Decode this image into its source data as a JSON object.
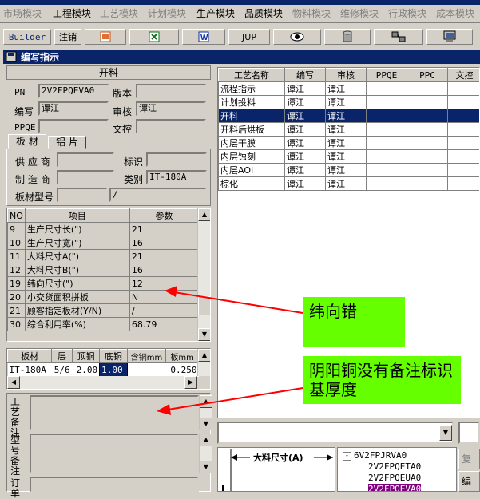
{
  "menu": [
    "市场模块",
    "工程模块",
    "工艺模块",
    "计划模块",
    "生产模块",
    "品质模块",
    "物料模块",
    "维修模块",
    "行政模块",
    "成本模块"
  ],
  "toolbar": {
    "builder": "Builder",
    "logout": "注销",
    "jup": "JUP"
  },
  "window_title": "编写指示",
  "section_title": "开料",
  "form": {
    "pn_label": "PN",
    "pn_value": "2V2FPQEVA0",
    "version_label": "版本",
    "version_value": "",
    "author_label": "编写",
    "author_value": "谭江",
    "review_label": "审核",
    "review_value": "谭江",
    "ppqe_label": "PPQE",
    "ppqe_value": "",
    "wenkong_label": "文控",
    "wenkong_value": ""
  },
  "tabs": [
    "板 材",
    "铝 片"
  ],
  "material": {
    "supplier_label": "供 应 商",
    "supplier_value": "",
    "mark_label": "标识",
    "mark_value": "",
    "maker_label": "制 造 商",
    "maker_value": "",
    "category_label": "类别",
    "category_value": "IT-180A",
    "model_label": "板材型号",
    "model_value": "",
    "model_value2": "/"
  },
  "param_table": {
    "headers": [
      "NO",
      "项目",
      "参数"
    ],
    "rows": [
      [
        "9",
        "生产尺寸长(\")",
        "21"
      ],
      [
        "10",
        "生产尺寸宽(\")",
        "16"
      ],
      [
        "11",
        "大料尺寸A(\")",
        "21"
      ],
      [
        "12",
        "大料尺寸B(\")",
        "16"
      ],
      [
        "19",
        "纬向尺寸(\")",
        "12"
      ],
      [
        "20",
        "小交货面积拼板",
        "N"
      ],
      [
        "21",
        "顾客指定板材(Y/N)",
        "/"
      ],
      [
        "30",
        "综合利用率(%)",
        "68.79"
      ]
    ]
  },
  "board_table": {
    "headers": [
      "板材",
      "层",
      "顶铜",
      "底铜",
      "含铜mm",
      "板mm"
    ],
    "row": [
      "IT-180A",
      "5/6",
      "2.00",
      "1.00",
      "",
      "0.250"
    ]
  },
  "remarks": {
    "process_note": "工艺备注",
    "model_note": "型号备注",
    "order_note": "订单"
  },
  "process_list": {
    "headers": [
      "工艺名称",
      "编写",
      "审核",
      "PPQE",
      "PPC",
      "文控"
    ],
    "rows": [
      [
        "流程指示",
        "谭江",
        "谭江"
      ],
      [
        "计划投料",
        "谭江",
        "谭江"
      ],
      [
        "开料",
        "谭江",
        "谭江"
      ],
      [
        "开料后烘板",
        "谭江",
        "谭江"
      ],
      [
        "内层干膜",
        "谭江",
        "谭江"
      ],
      [
        "内层蚀刻",
        "谭江",
        "谭江"
      ],
      [
        "内层AOI",
        "谭江",
        "谭江"
      ],
      [
        "棕化",
        "谭江",
        "谭江"
      ]
    ],
    "selected_index": 2
  },
  "diagram": {
    "dim_label": "大料尺寸(A)"
  },
  "tree": {
    "root": "6V2FPJRVA0",
    "items": [
      "2V2FPQETA0",
      "2V2FPQEUA0",
      "2V2FPQEVA0"
    ],
    "selected_index": 2
  },
  "side_buttons": [
    "复制",
    "编写"
  ],
  "annotations": [
    "纬向错",
    "阴阳铜没有备注标识基厚度"
  ],
  "colors": {
    "selection": "#0a246a",
    "callout": "#66ff00",
    "arrow": "#ff0000",
    "tree_selected": "#800080"
  }
}
